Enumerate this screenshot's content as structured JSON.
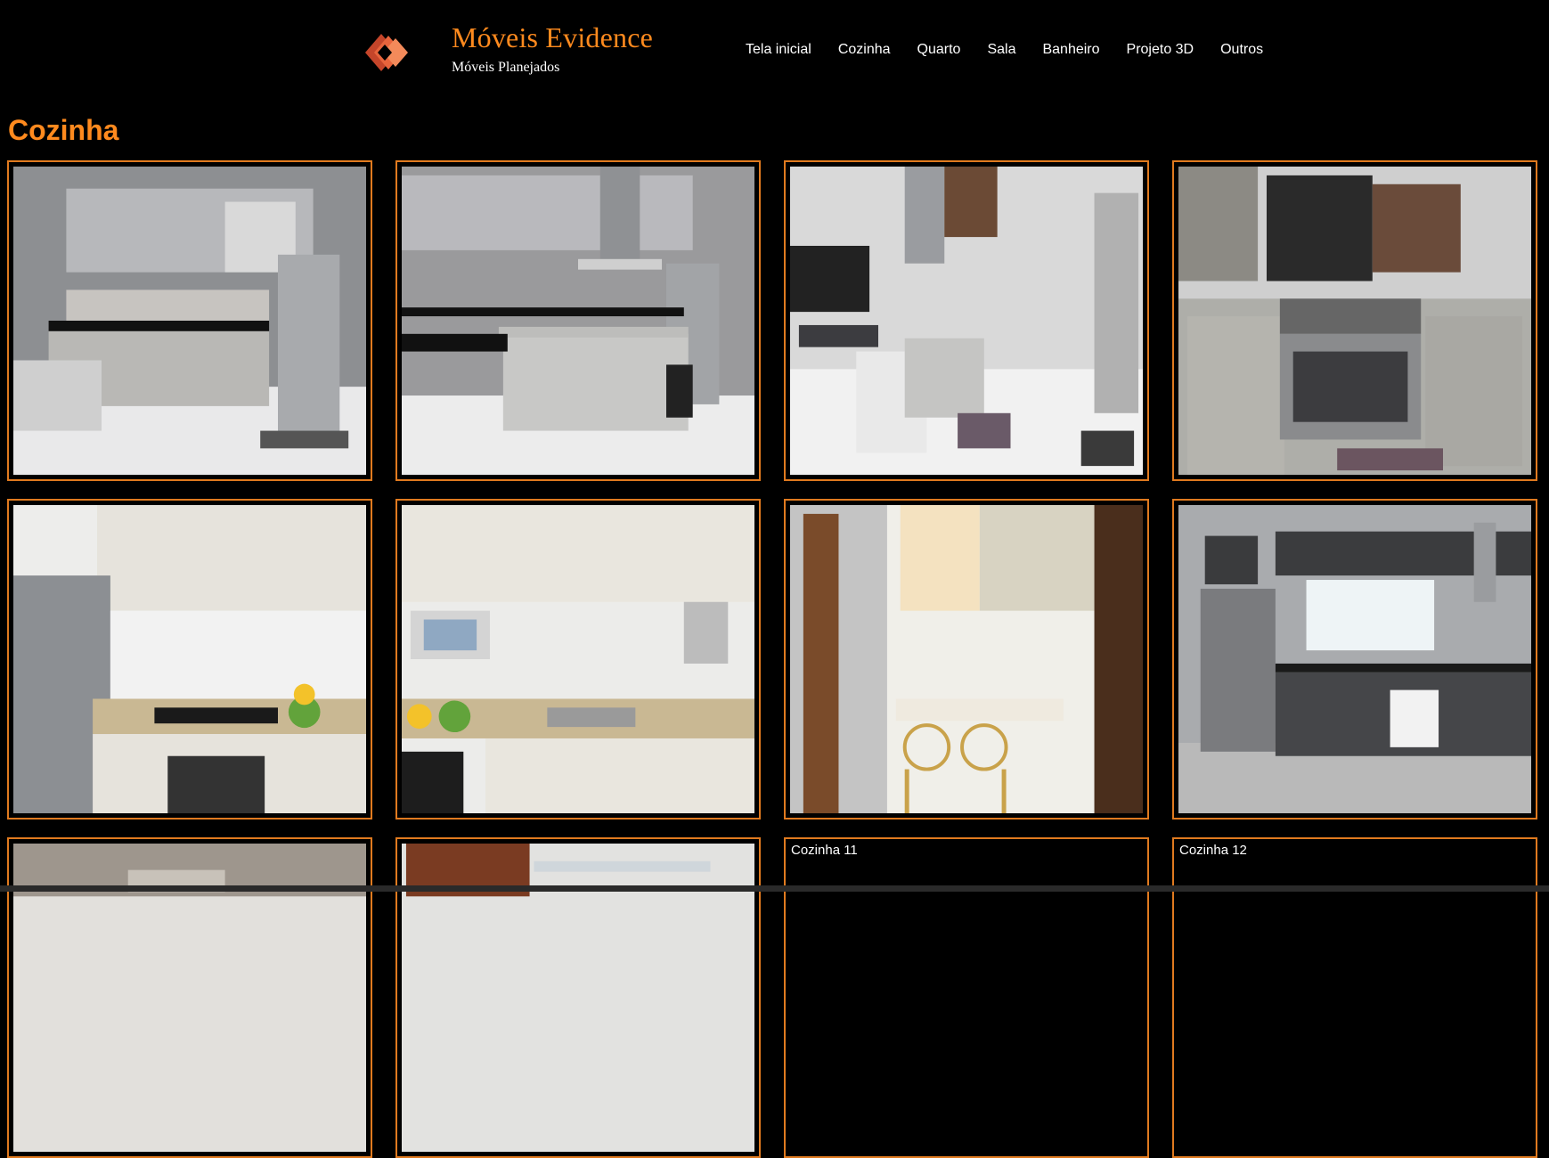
{
  "brand": {
    "title": "Móveis Evidence",
    "subtitle": "Móveis Planejados",
    "accent": "#ff8a1e"
  },
  "nav": [
    "Tela inicial",
    "Cozinha",
    "Quarto",
    "Sala",
    "Banheiro",
    "Projeto 3D",
    "Outros"
  ],
  "page": {
    "title": "Cozinha"
  },
  "gallery": [
    {
      "caption": "",
      "scene": "light-gray-kitchen-fridge"
    },
    {
      "caption": "",
      "scene": "kitchen-island-hood"
    },
    {
      "caption": "",
      "scene": "corridor-kitchen-island"
    },
    {
      "caption": "",
      "scene": "island-cooktop-oven"
    },
    {
      "caption": "",
      "scene": "white-cabinets-cooktop"
    },
    {
      "caption": "",
      "scene": "white-cabinets-sink"
    },
    {
      "caption": "",
      "scene": "breakfast-counter-stools"
    },
    {
      "caption": "",
      "scene": "dark-gray-kitchen"
    },
    {
      "caption": "",
      "scene": "wood-cabinets-partial"
    },
    {
      "caption": "",
      "scene": "wine-rack-partial"
    },
    {
      "caption": "Cozinha 11",
      "scene": ""
    },
    {
      "caption": "Cozinha 12",
      "scene": ""
    }
  ]
}
